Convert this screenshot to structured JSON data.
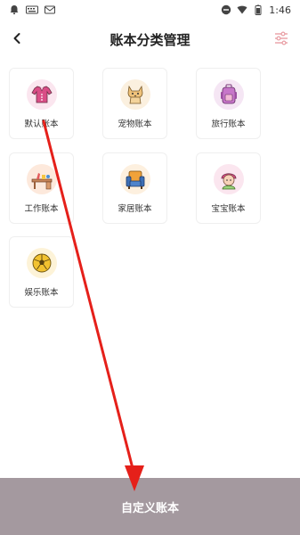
{
  "status_bar": {
    "time": "1:46",
    "icons": [
      "notification-icon",
      "keyboard-icon",
      "mail-icon",
      "dnd-icon",
      "wifi-icon",
      "battery-icon"
    ]
  },
  "header": {
    "title": "账本分类管理",
    "back_icon": "chevron-left-icon",
    "filter_icon": "sliders-icon"
  },
  "categories": [
    {
      "label": "默认账本",
      "icon": "shirt-icon",
      "bg": "#fbe6ef"
    },
    {
      "label": "宠物账本",
      "icon": "cat-icon",
      "bg": "#fbf0df"
    },
    {
      "label": "旅行账本",
      "icon": "backpack-icon",
      "bg": "#f5e6f4"
    },
    {
      "label": "工作账本",
      "icon": "desk-icon",
      "bg": "#fde9dc"
    },
    {
      "label": "家居账本",
      "icon": "armchair-icon",
      "bg": "#fdf0df"
    },
    {
      "label": "宝宝账本",
      "icon": "baby-icon",
      "bg": "#fbe6ef"
    },
    {
      "label": "娱乐账本",
      "icon": "soccer-ball-icon",
      "bg": "#fdf3d8"
    }
  ],
  "bottom": {
    "button_label": "自定义账本"
  },
  "colors": {
    "bottom_button": "#a4999f",
    "arrow": "#e5201a"
  }
}
